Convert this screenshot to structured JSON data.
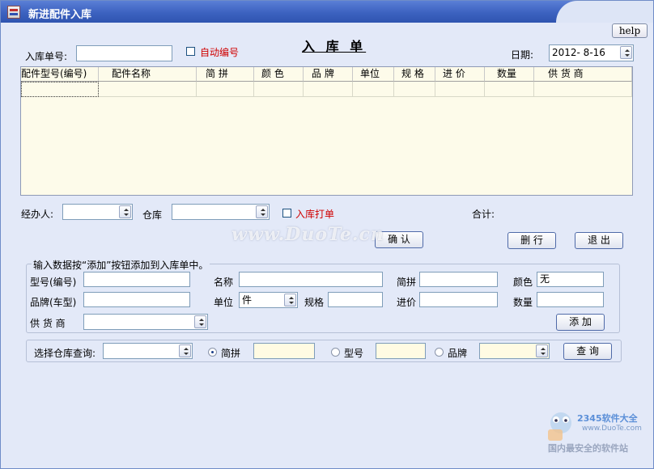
{
  "window": {
    "title": "新进配件入库",
    "help_label": "help"
  },
  "form": {
    "heading": "入 库 单",
    "order_no_label": "入库单号:",
    "order_no_value": "",
    "auto_number_label": "自动编号",
    "date_label": "日期:",
    "date_value": "2012- 8-16"
  },
  "grid": {
    "columns": [
      "配件型号(编号)",
      "配件名称",
      "简 拼",
      "颜 色",
      "品 牌",
      "单位",
      "规 格",
      "进 价",
      "数量",
      "供 货 商"
    ]
  },
  "footer": {
    "handler_label": "经办人:",
    "handler_value": "",
    "warehouse_label": "仓库",
    "warehouse_value": "",
    "print_label": "入库打单",
    "total_label": "合计:",
    "confirm_button": "确 认",
    "delete_button": "删 行",
    "exit_button": "退 出"
  },
  "entry": {
    "instruction": "输入数据按“添加”按钮添加到入库单中。",
    "model_label": "型号(编号)",
    "name_label": "名称",
    "pinyin_label": "简拼",
    "color_label": "颜色",
    "color_value": "无",
    "brand_label": "品牌(车型)",
    "unit_label": "单位",
    "unit_value": "件",
    "spec_label": "规格",
    "price_label": "进价",
    "qty_label": "数量",
    "supplier_label": "供 货 商",
    "add_button": "添 加"
  },
  "query": {
    "warehouse_label": "选择仓库查询:",
    "pinyin_radio": "简拼",
    "model_radio": "型号",
    "brand_radio": "品牌",
    "query_button": "查 询"
  },
  "watermark": {
    "text": "www.DuoTe.cn",
    "logo_text": "2345软件大全",
    "logo_url": "www.DuoTe.com",
    "slogan": "国内最安全的软件站"
  },
  "colors": {
    "titlebar": "#3c62c0",
    "grid_bg": "#fdfbea",
    "window_bg": "#e3e9f8",
    "accent_red": "#d00000"
  }
}
